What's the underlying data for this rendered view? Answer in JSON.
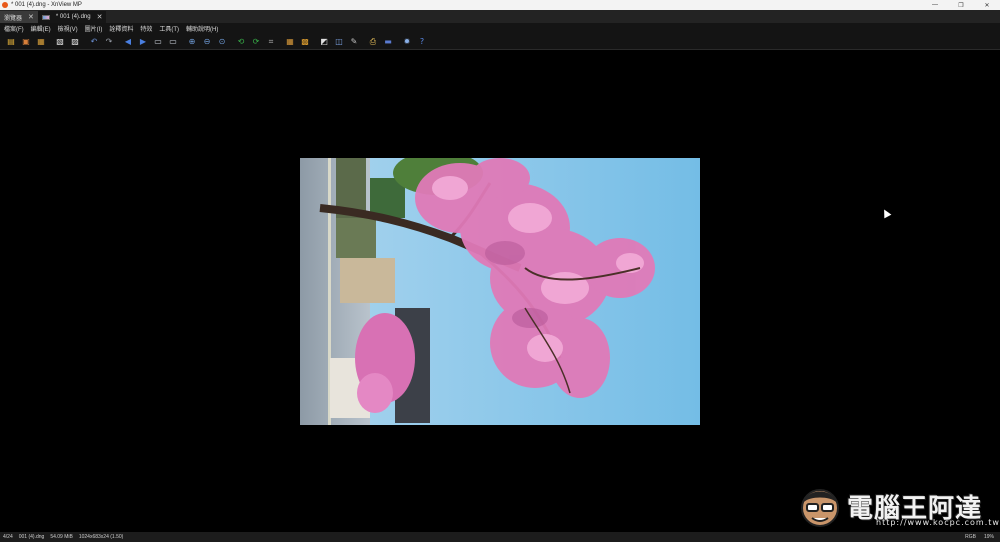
{
  "window": {
    "title": "* 001 (4).dng - XnView MP",
    "minimize": "—",
    "maximize": "❐",
    "close": "✕"
  },
  "tabs": [
    {
      "label": "瀏覽器",
      "close": "✕"
    },
    {
      "label": "* 001 (4).dng",
      "close": "✕"
    }
  ],
  "menu": [
    "檔案(F)",
    "編輯(E)",
    "檢視(V)",
    "圖片(I)",
    "詮釋資料",
    "特效",
    "工具(T)",
    "輔助說明(H)"
  ],
  "toolbar": {
    "icons": [
      {
        "name": "open-browser-icon",
        "color": "#e7b33a"
      },
      {
        "name": "open-file-icon",
        "color": "#d9803a"
      },
      {
        "name": "fullscreen-icon",
        "color": "#d9a03a"
      },
      {
        "name": "save-icon",
        "color": "#e8e8e8"
      },
      {
        "name": "save-as-icon",
        "color": "#e8e8e8"
      },
      {
        "name": "undo-icon",
        "color": "#6a8fd4"
      },
      {
        "name": "redo-icon",
        "color": "#9aa0aa"
      },
      {
        "name": "previous-icon",
        "color": "#4a7fe0"
      },
      {
        "name": "next-icon",
        "color": "#4a7fe0"
      },
      {
        "name": "first-page-icon",
        "color": "#cfd6df"
      },
      {
        "name": "last-page-icon",
        "color": "#cfd6df"
      },
      {
        "name": "zoom-in-icon",
        "color": "#6f9cd8"
      },
      {
        "name": "zoom-out-icon",
        "color": "#6f9cd8"
      },
      {
        "name": "zoom-fit-icon",
        "color": "#6f9cd8"
      },
      {
        "name": "rotate-left-icon",
        "color": "#39b34a"
      },
      {
        "name": "rotate-right-icon",
        "color": "#39b34a"
      },
      {
        "name": "crop-icon",
        "color": "#b0b0b0"
      },
      {
        "name": "adjust-icon",
        "color": "#d99a3a"
      },
      {
        "name": "slideshow-icon",
        "color": "#e0a030"
      },
      {
        "name": "effects-icon",
        "color": "#e0e0e0"
      },
      {
        "name": "batch-icon",
        "color": "#7aa0e0"
      },
      {
        "name": "paint-icon",
        "color": "#c0c0c0"
      },
      {
        "name": "print-icon",
        "color": "#e8c05a"
      },
      {
        "name": "scan-icon",
        "color": "#5a7ad0"
      },
      {
        "name": "settings-icon",
        "color": "#8ab0e8"
      },
      {
        "name": "help-icon",
        "color": "#5a8ae8"
      }
    ]
  },
  "watermark": {
    "text": "電腦王阿達",
    "url": "http://www.kocpc.com.tw"
  },
  "status": {
    "index": "4/24",
    "filename": "001 (4).dng",
    "filesize": "54.09 MiB",
    "dimensions": "1024x683x24 (1.50)",
    "right": [
      "RGB",
      "19%"
    ]
  },
  "colors": {
    "sky": "#7fc1e6",
    "blossom": "#e27ab8"
  }
}
